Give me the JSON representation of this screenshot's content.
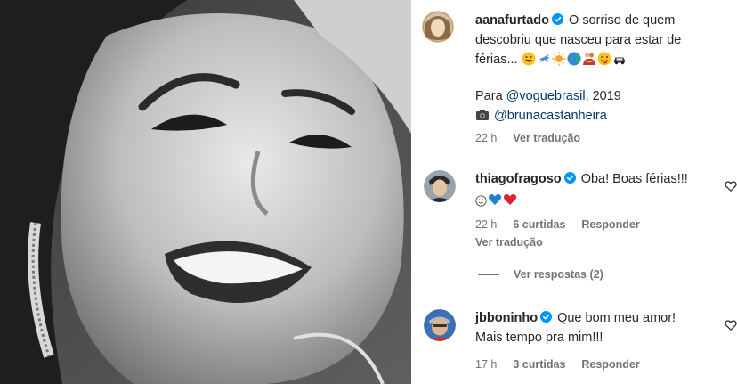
{
  "caption": {
    "username": "aanafurtado",
    "text_lines": [
      "O sorriso de quem",
      "descobriu que nasceu para estar de",
      "férias..."
    ],
    "emojis": [
      "grinning-face",
      "airplane",
      "sun",
      "globe",
      "people-hugging",
      "winking-tongue-face",
      "car"
    ],
    "credit_prefix": "Para",
    "credit_mention": "@voguebrasil",
    "credit_suffix": ", 2019",
    "photo_mention": "@brunacastanheira",
    "time": "22 h",
    "translate": "Ver tradução"
  },
  "comments": [
    {
      "username": "thiagofragoso",
      "text": "Oba! Boas férias!!!",
      "emojis": [
        "smiling-face",
        "blue-heart",
        "red-heart"
      ],
      "time": "22 h",
      "likes": "6 curtidas",
      "reply": "Responder",
      "translate": "Ver tradução",
      "view_replies": "Ver respostas (2)"
    },
    {
      "username": "jbboninho",
      "text_lines": [
        "Que bom meu amor!",
        "Mais tempo pra mim!!!"
      ],
      "time": "17 h",
      "likes": "3 curtidas",
      "reply": "Responder"
    }
  ],
  "colors": {
    "text": "#262626",
    "muted": "#737373",
    "mention": "#00376b",
    "verified": "#0095f6"
  }
}
